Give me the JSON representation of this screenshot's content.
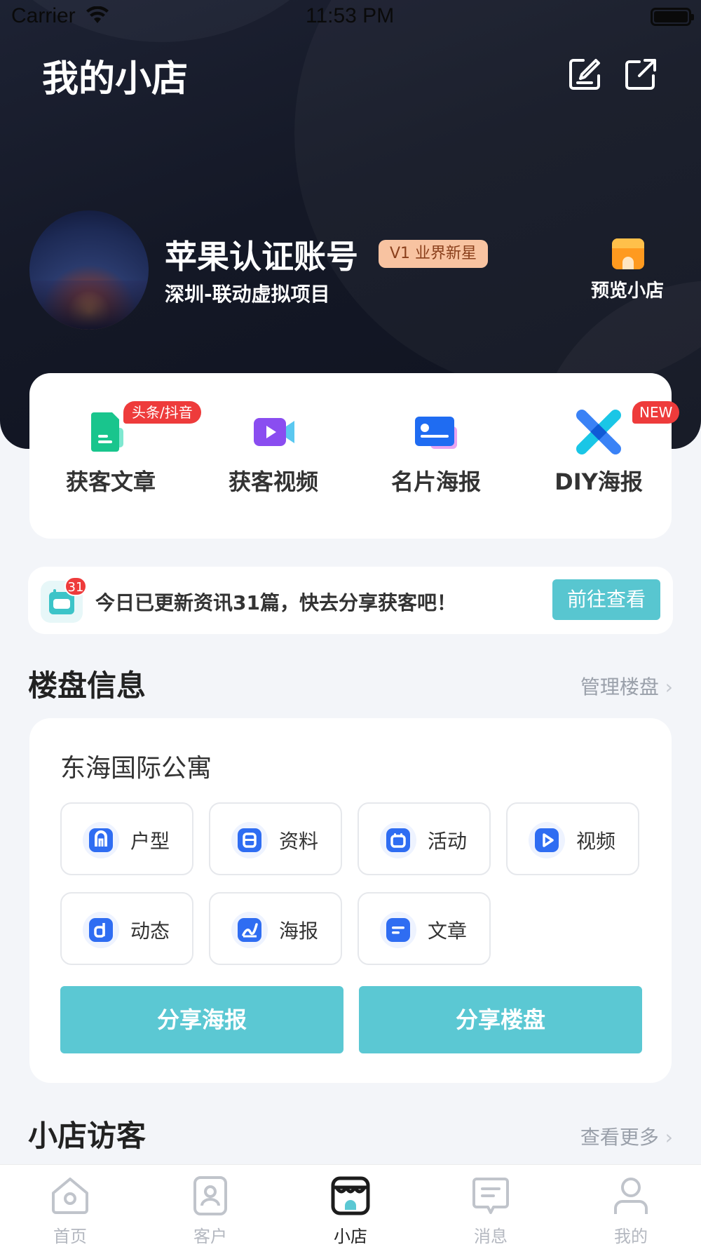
{
  "status_bar": {
    "carrier": "Carrier",
    "time": "11:53 PM"
  },
  "header": {
    "title": "我的小店",
    "icons": [
      "edit-icon",
      "share-icon"
    ]
  },
  "profile": {
    "name": "苹果认证账号",
    "level_badge": "V1 业界新星",
    "project": "深圳-联动虚拟项目",
    "preview_label": "预览小店"
  },
  "tools": [
    {
      "label": "获客文章",
      "tag": "头条/抖音",
      "icon": "article-icon"
    },
    {
      "label": "获客视频",
      "tag": "",
      "icon": "video-icon"
    },
    {
      "label": "名片海报",
      "tag": "",
      "icon": "card-poster-icon"
    },
    {
      "label": "DIY海报",
      "tag": "NEW",
      "icon": "diy-poster-icon"
    }
  ],
  "news": {
    "count": "31",
    "text": "今日已更新资讯31篇，快去分享获客吧！",
    "button": "前往查看"
  },
  "property_section": {
    "title": "楼盘信息",
    "link": "管理楼盘",
    "property_name": "东海国际公寓",
    "chips": [
      {
        "label": "户型",
        "icon": "floorplan-icon"
      },
      {
        "label": "资料",
        "icon": "document-icon"
      },
      {
        "label": "活动",
        "icon": "calendar-icon"
      },
      {
        "label": "视频",
        "icon": "play-icon"
      },
      {
        "label": "动态",
        "icon": "news-feed-icon"
      },
      {
        "label": "海报",
        "icon": "poster-icon"
      },
      {
        "label": "文章",
        "icon": "text-icon"
      }
    ],
    "share_poster": "分享海报",
    "share_property": "分享楼盘"
  },
  "visitors_section": {
    "title": "小店访客",
    "link": "查看更多"
  },
  "tabbar": [
    {
      "label": "首页",
      "icon": "home-icon",
      "active": false
    },
    {
      "label": "客户",
      "icon": "contacts-icon",
      "active": false
    },
    {
      "label": "小店",
      "icon": "store-icon",
      "active": true
    },
    {
      "label": "消息",
      "icon": "message-icon",
      "active": false
    },
    {
      "label": "我的",
      "icon": "profile-icon",
      "active": false
    }
  ],
  "colors": {
    "accent": "#5bc8d3",
    "hero_bg": "#141826",
    "tag_red": "#ee3b3b",
    "chip_icon_blue": "#2f6df2",
    "store_orange": "#ff9a1f"
  }
}
